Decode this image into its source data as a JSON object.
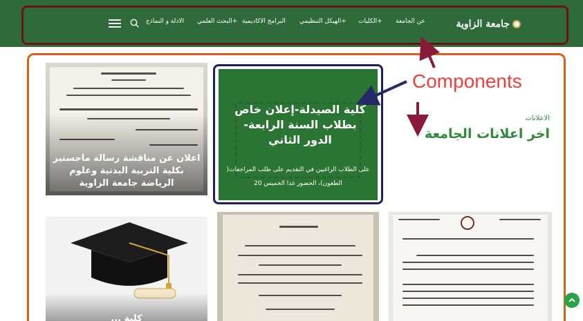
{
  "site": {
    "logo_text": "جامعة الزاوية"
  },
  "nav": {
    "items": [
      {
        "label": "عن الجامعة"
      },
      {
        "label": "+الكليات"
      },
      {
        "label": "+الهيكل التنظيمي"
      },
      {
        "label": "البرامج الاكاديمية"
      },
      {
        "label": "+البحث العلمي"
      },
      {
        "label": "الادلة و النماذج"
      }
    ]
  },
  "icons": {
    "search": "search-icon",
    "menu": "hamburger-menu-icon",
    "scroll_top": "chevron-up-icon"
  },
  "section": {
    "label": "الاعلانات",
    "title": "اخر اعلانات الجامعة"
  },
  "cards": [
    {
      "title": "اعلان عن مناقشة رسالة ماجستير بكلية التربية البدنية وعلوم الرياضة جامعة الزاوية",
      "image": "document-photo"
    },
    {
      "title": "كلية الصيدلة-إعلان خاص بطلاب السنة الرابعة- الدور الثاني",
      "body": "على الطلاب الراغبين في التقديم على طلب المراجعات( الطعون)، الحضور غدا الخميس 20"
    },
    {
      "title": "",
      "image": "document-photo"
    },
    {
      "title": "كلية ...",
      "image": "graduation-cap-photo"
    },
    {
      "title": "",
      "image": "document-photo"
    },
    {
      "title": "",
      "image": "document-photo"
    }
  ],
  "annotation": {
    "text": "Components"
  },
  "colors": {
    "nav_bg": "#2f6b3a",
    "accent_green": "#2f8a3a",
    "annotation_red": "#ef3f3f",
    "frame_orange": "#d4621b",
    "outline_navy": "#1d1f59"
  }
}
